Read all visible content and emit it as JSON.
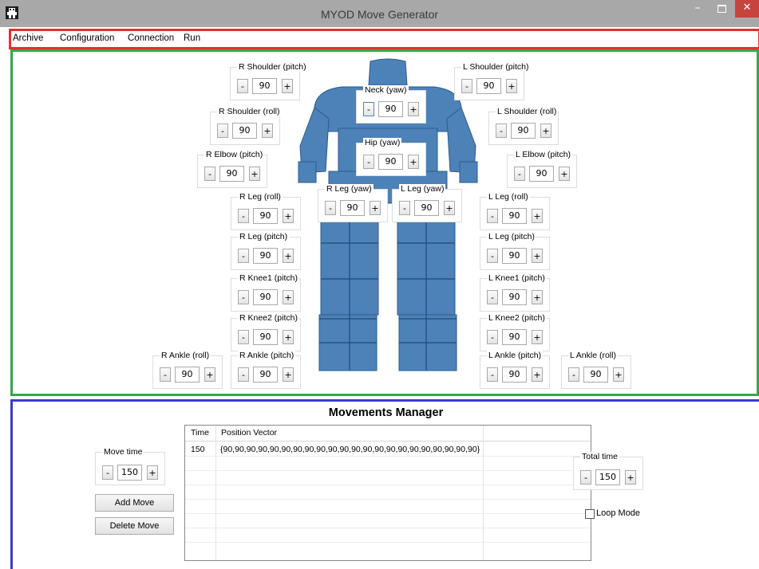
{
  "window": {
    "title": "MYOD Move Generator",
    "minimize_glyph": "–",
    "close_glyph": "✕"
  },
  "menu": {
    "items": [
      "Archive",
      "Configuration",
      "Connection",
      "Run"
    ]
  },
  "joints": [
    {
      "label": "R Shoulder (pitch)",
      "value": "90"
    },
    {
      "label": "Neck (yaw)",
      "value": "90"
    },
    {
      "label": "L Shoulder (pitch)",
      "value": "90"
    },
    {
      "label": "R Shoulder (roll)",
      "value": "90"
    },
    {
      "label": "L Shoulder (roll)",
      "value": "90"
    },
    {
      "label": "Hip (yaw)",
      "value": "90"
    },
    {
      "label": "R Elbow (pitch)",
      "value": "90"
    },
    {
      "label": "L Elbow (pitch)",
      "value": "90"
    },
    {
      "label": "R Leg (yaw)",
      "value": "90"
    },
    {
      "label": "L Leg (yaw)",
      "value": "90"
    },
    {
      "label": "R Leg (roll)",
      "value": "90"
    },
    {
      "label": "L Leg (roll)",
      "value": "90"
    },
    {
      "label": "R Leg (pitch)",
      "value": "90"
    },
    {
      "label": "L Leg (pitch)",
      "value": "90"
    },
    {
      "label": "R Knee1 (pitch)",
      "value": "90"
    },
    {
      "label": "L Knee1 (pitch)",
      "value": "90"
    },
    {
      "label": "R Knee2 (pitch)",
      "value": "90"
    },
    {
      "label": "L Knee2 (pitch)",
      "value": "90"
    },
    {
      "label": "R Ankle (roll)",
      "value": "90"
    },
    {
      "label": "R Ankle (pitch)",
      "value": "90"
    },
    {
      "label": "L Ankle (pitch)",
      "value": "90"
    },
    {
      "label": "L Ankle (roll)",
      "value": "90"
    }
  ],
  "stepper": {
    "minus": "-",
    "plus": "+"
  },
  "movements": {
    "title": "Movements Manager",
    "move_time": {
      "label": "Move time",
      "value": "150"
    },
    "total_time": {
      "label": "Total time",
      "value": "150"
    },
    "add_button": "Add Move",
    "delete_button": "Delete Move",
    "loop_mode": {
      "label": "Loop Mode",
      "checked": false
    },
    "table": {
      "columns": [
        "Time",
        "Position Vector"
      ],
      "rows": [
        {
          "time": "150",
          "vector": "{90,90,90,90,90,90,90,90,90,90,90,90,90,90,90,90,90,90,90,90,90,90}"
        }
      ]
    }
  },
  "colors": {
    "menu_border": "#e6302b",
    "robot_panel_border": "#31a94a",
    "movements_panel_border": "#3a3fbf",
    "robot_body": "#4d82b8",
    "titlebar": "#a8a8a8",
    "close_button": "#c7433d"
  }
}
